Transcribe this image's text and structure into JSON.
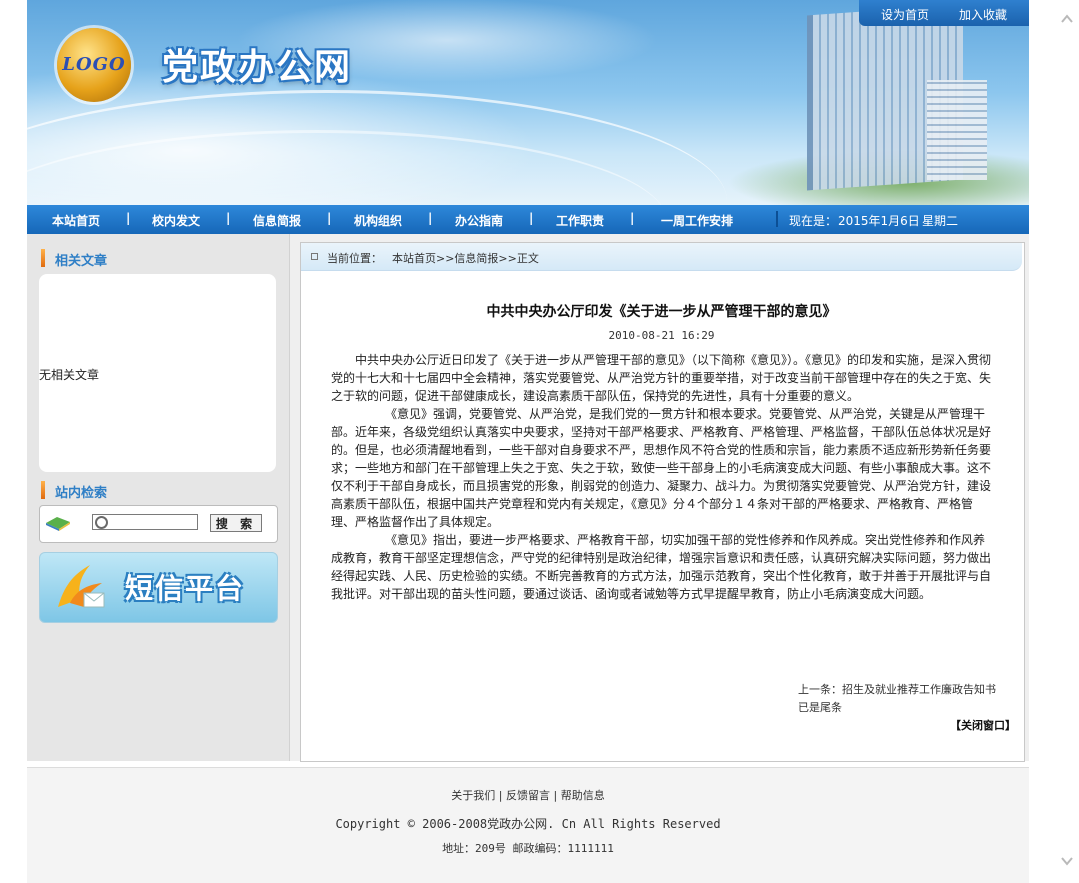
{
  "header": {
    "logo_text": "LOGO",
    "site_title": "党政办公网",
    "set_home": "设为首页",
    "add_favorite": "加入收藏"
  },
  "nav": {
    "items": [
      "本站首页",
      "校内发文",
      "信息简报",
      "机构组织",
      "办公指南",
      "工作职责",
      "一周工作安排"
    ],
    "separator": "|",
    "date_label": "现在是：",
    "date_value": "2015年1月6日",
    "weekday": "星期二"
  },
  "sidebar": {
    "related_title": "相关文章",
    "related_empty": "无相关文章",
    "search_title": "站内检索",
    "search_button": "搜 索",
    "search_placeholder": "",
    "sms_banner": "短信平台"
  },
  "breadcrumb": {
    "label": "当前位置：",
    "path": "本站首页>>信息简报>>正文"
  },
  "article": {
    "title": "中共中央办公厅印发《关于进一步从严管理干部的意见》",
    "date": "2010-08-21 16:29",
    "paragraphs": [
      "中共中央办公厅近日印发了《关于进一步从严管理干部的意见》（以下简称《意见》）。《意见》的印发和实施，是深入贯彻党的十七大和十七届四中全会精神，落实党要管党、从严治党方针的重要举措，对于改变当前干部管理中存在的失之于宽、失之于软的问题，促进干部健康成长，建设高素质干部队伍，保持党的先进性，具有十分重要的意义。",
      "《意见》强调，党要管党、从严治党，是我们党的一贯方针和根本要求。党要管党、从严治党，关键是从严管理干部。近年来，各级党组织认真落实中央要求，坚持对干部严格要求、严格教育、严格管理、严格监督，干部队伍总体状况是好的。但是，也必须清醒地看到，一些干部对自身要求不严，思想作风不符合党的性质和宗旨，能力素质不适应新形势新任务要求；一些地方和部门在干部管理上失之于宽、失之于软，致使一些干部身上的小毛病演变成大问题、有些小事酿成大事。这不仅不利于干部自身成长，而且损害党的形象，削弱党的创造力、凝聚力、战斗力。为贯彻落实党要管党、从严治党方针，建设高素质干部队伍，根据中国共产党章程和党内有关规定，《意见》分４个部分１４条对干部的严格要求、严格教育、严格管理、严格监督作出了具体规定。",
      "《意见》指出，要进一步严格要求、严格教育干部，切实加强干部的党性修养和作风养成。突出党性修养和作风养成教育，教育干部坚定理想信念，严守党的纪律特别是政治纪律，增强宗旨意识和责任感，认真研究解决实际问题，努力做出经得起实践、人民、历史检验的实绩。不断完善教育的方式方法，加强示范教育，突出个性化教育，敢于并善于开展批评与自我批评。对干部出现的苗头性问题，要通过谈话、函询或者诫勉等方式早提醒早教育，防止小毛病演变成大问题。"
    ],
    "prev": "上一条：招生及就业推荐工作廉政告知书",
    "next": "已是尾条",
    "close": "【关闭窗口】"
  },
  "footer": {
    "links": "关于我们 | 反馈留言 | 帮助信息",
    "copyright": "Copyright © 2006-2008党政办公网. Cn All Rights Reserved",
    "address": "地址：209号 邮政编码：1111111"
  },
  "colors": {
    "nav_bg": "#1f74c6",
    "accent_title": "#2f7fc6",
    "sidebar_bg": "#e6e6e6"
  }
}
